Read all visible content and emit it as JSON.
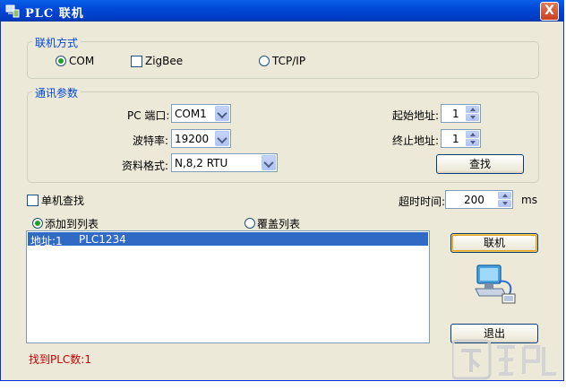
{
  "window": {
    "title": "PLC 联机",
    "close_label": "X"
  },
  "connection_mode": {
    "legend": "联机方式",
    "options": [
      {
        "label": "COM",
        "selected": true
      },
      {
        "label": "ZigBee",
        "checkbox": true,
        "checked": false
      },
      {
        "label": "TCP/IP",
        "selected": false
      }
    ]
  },
  "comm_params": {
    "legend": "通讯参数",
    "pc_port_label": "PC 端口:",
    "pc_port_value": "COM1",
    "baud_label": "波特率:",
    "baud_value": "19200",
    "format_label": "资料格式:",
    "format_value": "N,8,2 RTU",
    "start_addr_label": "起始地址:",
    "start_addr_value": "1",
    "end_addr_label": "终止地址:",
    "end_addr_value": "1",
    "search_button": "查找"
  },
  "single_search": {
    "label": "单机查找",
    "checked": false
  },
  "timeout": {
    "label": "超时时间:",
    "value": "200",
    "unit": "ms"
  },
  "list_mode": {
    "add_label": "添加到列表",
    "add_selected": true,
    "overwrite_label": "覆盖列表",
    "overwrite_selected": false
  },
  "plc_list": {
    "rows": [
      {
        "address": "地址:1",
        "name": "PLC1234",
        "selected": true
      }
    ]
  },
  "actions": {
    "connect_button": "联机",
    "exit_button": "退出"
  },
  "status": {
    "found_text": "找到PLC数:1"
  },
  "icons": {
    "app": "plc-app-icon",
    "network": "network-computer-icon"
  },
  "colors": {
    "title_bar": "#0054e3",
    "accent": "#0046d5",
    "selection": "#316ac5",
    "status_text": "#c00000"
  },
  "watermark": "下载吧"
}
